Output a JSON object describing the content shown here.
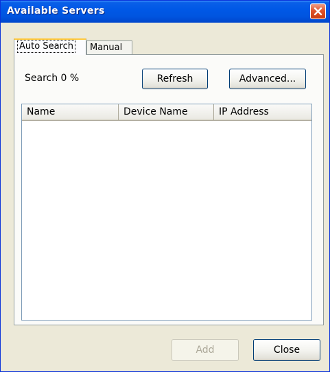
{
  "window": {
    "title": "Available Servers"
  },
  "tabs": [
    {
      "label": "Auto Search",
      "active": true
    },
    {
      "label": "Manual",
      "active": false
    }
  ],
  "auto_search": {
    "search_status": "Search 0 %",
    "refresh_label": "Refresh",
    "advanced_label": "Advanced...",
    "columns": [
      "Name",
      "Device Name",
      "IP Address"
    ],
    "rows": []
  },
  "footer": {
    "add_label": "Add",
    "close_label": "Close"
  },
  "colors": {
    "titlebar": "#0058e6",
    "close_button": "#e0532c",
    "window_bg": "#ece9d8",
    "active_tab_accent": "#ffc83c",
    "disabled_text": "#aca899"
  },
  "icons": {
    "close": "close-icon"
  }
}
